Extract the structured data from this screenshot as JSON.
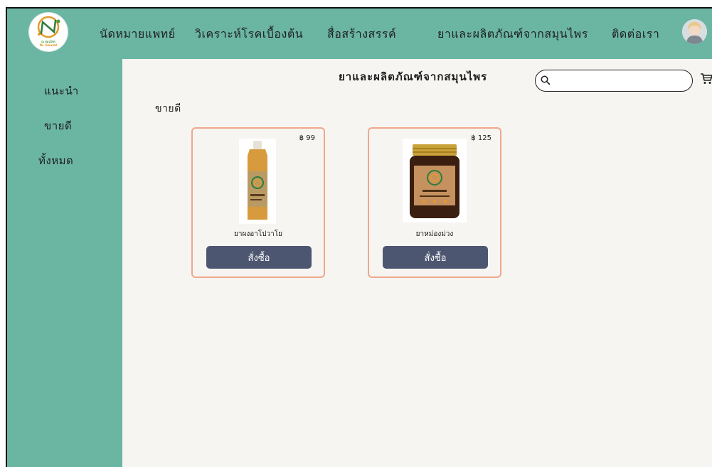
{
  "brand": {
    "logo_text": "ณ สมุนไพร",
    "logo_subtext": "Nr. Smunbl"
  },
  "nav": {
    "items": [
      {
        "label": "นัดหมายแพทย์"
      },
      {
        "label": "วิเคราะห์โรคเบื้องต้น"
      },
      {
        "label": "สื่อสร้างสรรค์"
      },
      {
        "label": "ยาและผลิตภัณฑ์จากสมุนไพร"
      },
      {
        "label": "ติดต่อเรา"
      }
    ]
  },
  "sidebar": {
    "items": [
      {
        "label": "แนะนำ"
      },
      {
        "label": "ขายดี"
      },
      {
        "label": "ทั้งหมด"
      }
    ]
  },
  "main": {
    "title": "ยาและผลิตภัณฑ์จากสมุนไพร",
    "search": {
      "value": "",
      "placeholder": ""
    },
    "section_label": "ขายดี",
    "products": [
      {
        "name": "ยาผงอาโปวาโย",
        "price": "฿ 99",
        "buy_label": "สั่งซื้อ"
      },
      {
        "name": "ยาหม่องม่วง",
        "price": "฿ 125",
        "buy_label": "สั่งซื้อ"
      }
    ]
  },
  "colors": {
    "sidebar_bg": "#6bb6a3",
    "content_bg": "#f7f5f2",
    "card_border": "#efa78c",
    "button_bg": "#4d5671"
  },
  "icons": [
    "search-icon",
    "cart-icon",
    "avatar"
  ]
}
